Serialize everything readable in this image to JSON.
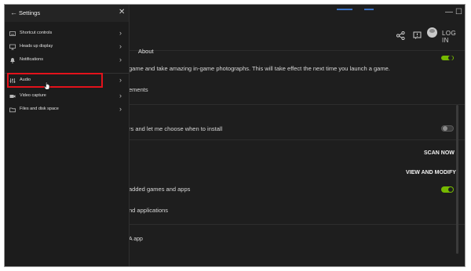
{
  "drawer": {
    "title": "Settings",
    "items": [
      {
        "label": "Shortcut controls",
        "icon": "keyboard-icon"
      },
      {
        "label": "Heads up display",
        "icon": "monitor-icon"
      },
      {
        "label": "Notifications",
        "icon": "bell-icon"
      },
      {
        "label": "Audio",
        "icon": "audio-levels-icon"
      },
      {
        "label": "Video capture",
        "icon": "video-camera-icon"
      },
      {
        "label": "Files and disk space",
        "icon": "folder-icon"
      }
    ]
  },
  "header": {
    "login_label": "LOG IN",
    "tab_about": "About"
  },
  "main": {
    "text1": "game and take amazing in-game photographs. This will take effect the next time you launch a game.",
    "text2": "ements",
    "text3": "rs and let me choose when to install",
    "scan_now": "SCAN NOW",
    "view_modify": "VIEW AND MODIFY",
    "text4": "added games and apps",
    "text5": "nd applications",
    "text6": "A app"
  },
  "colors": {
    "accent_green": "#76b900",
    "highlight_red": "#e3121b"
  }
}
